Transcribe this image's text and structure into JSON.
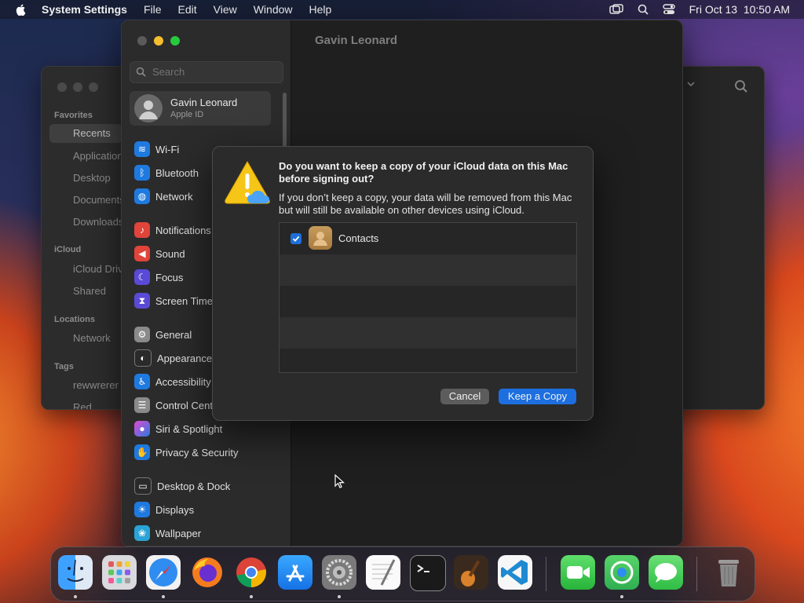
{
  "menubar": {
    "app_name": "System Settings",
    "items": [
      "File",
      "Edit",
      "View",
      "Window",
      "Help"
    ],
    "datetime": "Fri Oct 13  10:50 AM"
  },
  "finder": {
    "favorites_label": "Favorites",
    "favorites": [
      "Recents",
      "Applications",
      "Desktop",
      "Documents",
      "Downloads"
    ],
    "icloud_label": "iCloud",
    "icloud": [
      "iCloud Drive",
      "Shared"
    ],
    "locations_label": "Locations",
    "locations": [
      "Network"
    ],
    "tags_label": "Tags",
    "tags": [
      "rewwrerer",
      "Red"
    ]
  },
  "settings": {
    "search_placeholder": "Search",
    "account": {
      "name": "Gavin Leonard",
      "subtitle": "Apple ID"
    },
    "header_title": "Gavin Leonard",
    "items": [
      {
        "label": "Wi-Fi",
        "color": "#1f7ae0"
      },
      {
        "label": "Bluetooth",
        "color": "#1f7ae0"
      },
      {
        "label": "Network",
        "color": "#1f7ae0"
      },
      {
        "label": "Notifications",
        "color": "#e0443a"
      },
      {
        "label": "Sound",
        "color": "#e0443a"
      },
      {
        "label": "Focus",
        "color": "#5a4ad6"
      },
      {
        "label": "Screen Time",
        "color": "#5a4ad6"
      },
      {
        "label": "General",
        "color": "#8a8a8a"
      },
      {
        "label": "Appearance",
        "color": "#2a2a2a"
      },
      {
        "label": "Accessibility",
        "color": "#1f7ae0"
      },
      {
        "label": "Control Center",
        "color": "#8a8a8a"
      },
      {
        "label": "Siri & Spotlight",
        "color": "#b24fd6"
      },
      {
        "label": "Privacy & Security",
        "color": "#1f7ae0"
      },
      {
        "label": "Desktop & Dock",
        "color": "#2a2a2a"
      },
      {
        "label": "Displays",
        "color": "#1f7ae0"
      },
      {
        "label": "Wallpaper",
        "color": "#2aa3d6"
      }
    ]
  },
  "dialog": {
    "heading": "Do you want to keep a copy of your iCloud data on this Mac before signing out?",
    "body": "If you don’t keep a copy, your data will be removed from this Mac but will still be available on other devices using iCloud.",
    "list_item": "Contacts",
    "checked": true,
    "cancel_label": "Cancel",
    "keep_label": "Keep a Copy"
  },
  "dock": {
    "apps": [
      "finder-icon",
      "launchpad-icon",
      "safari-icon",
      "firefox-icon",
      "chrome-icon",
      "app-store-icon",
      "system-settings-icon",
      "textedit-icon",
      "terminal-icon",
      "garageband-icon",
      "vscode-icon",
      "facetime-icon",
      "find-my-icon",
      "messages-icon",
      "trash-icon"
    ]
  },
  "colors": {
    "accent": "#1d6fe0",
    "warning": "#f5c518"
  }
}
